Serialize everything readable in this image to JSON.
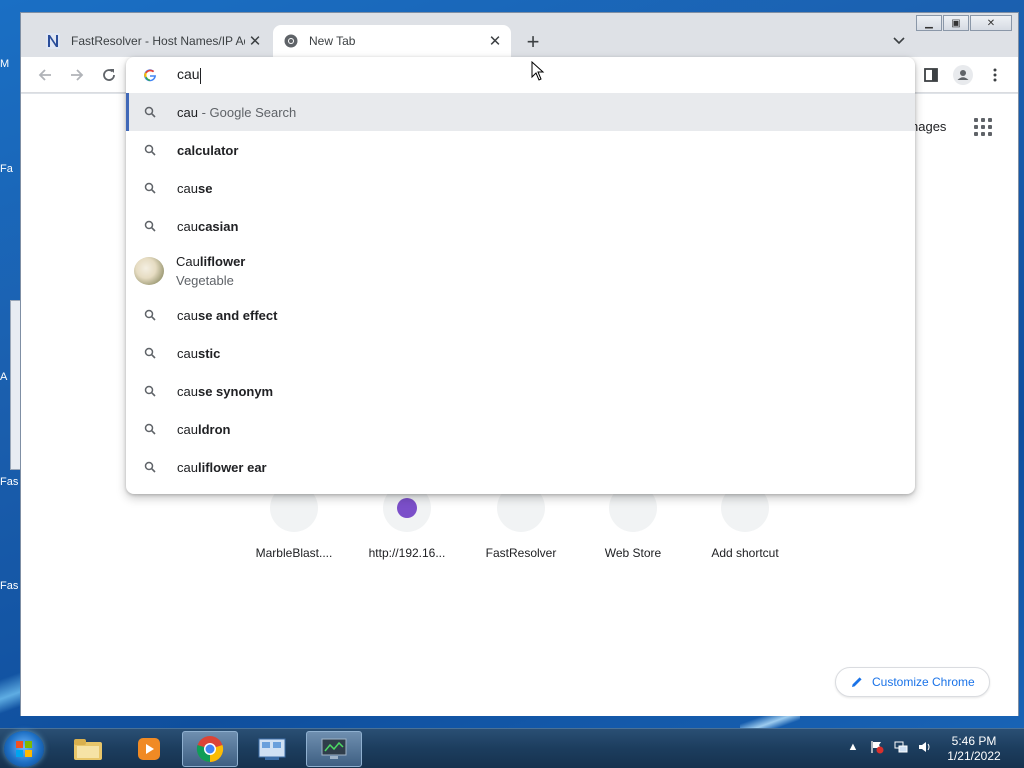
{
  "desktop": {
    "fragments": [
      "M",
      "Fa",
      "A",
      "Fas",
      "Fas"
    ]
  },
  "browser": {
    "tabs": [
      {
        "title": "FastResolver - Host Names/IP Ad",
        "icon": "fastresolver-icon"
      },
      {
        "title": "New Tab",
        "icon": "chrome-icon"
      }
    ],
    "omnibox": {
      "typed": "cau",
      "suggestions": [
        {
          "prefix": "cau",
          "rest": "",
          "suffix": "Google Search",
          "separator": " - ",
          "icon": "search-icon"
        },
        {
          "prefix": "",
          "rest": "calculator",
          "icon": "search-icon"
        },
        {
          "prefix": "cau",
          "rest": "se",
          "icon": "search-icon"
        },
        {
          "prefix": "cau",
          "rest": "casian",
          "icon": "search-icon"
        },
        {
          "prefix": "Cau",
          "rest": "liflower",
          "subtitle": "Vegetable",
          "icon": "cauliflower-image"
        },
        {
          "prefix": "cau",
          "rest": "se and effect",
          "icon": "search-icon"
        },
        {
          "prefix": "cau",
          "rest": "stic",
          "icon": "search-icon"
        },
        {
          "prefix": "cau",
          "rest": "se synonym",
          "icon": "search-icon"
        },
        {
          "prefix": "cau",
          "rest": "ldron",
          "icon": "search-icon"
        },
        {
          "prefix": "cau",
          "rest": "liflower ear",
          "icon": "search-icon"
        }
      ]
    },
    "ntp": {
      "images_link": "nages",
      "shortcuts": [
        {
          "label": "MarbleBlast...."
        },
        {
          "label": "http://192.16..."
        },
        {
          "label": "FastResolver"
        },
        {
          "label": "Web Store"
        },
        {
          "label": "Add shortcut"
        }
      ],
      "customize_label": "Customize Chrome"
    }
  },
  "taskbar": {
    "clock_time": "5:46 PM",
    "clock_date": "1/21/2022"
  }
}
